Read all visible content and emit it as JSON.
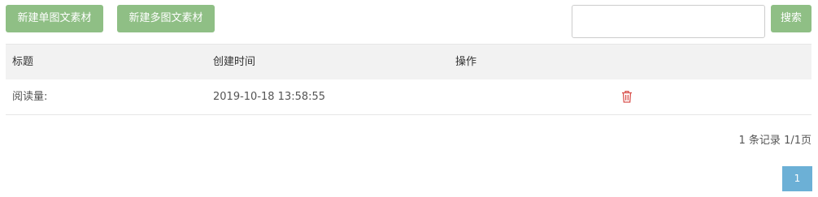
{
  "toolbar": {
    "new_single_label": "新建单图文素材",
    "new_multi_label": "新建多图文素材",
    "search_value": "",
    "search_placeholder": "",
    "search_label": "搜索"
  },
  "table": {
    "headers": [
      "标题",
      "创建时间",
      "操作"
    ],
    "rows": [
      {
        "title": "阅读量:",
        "created": "2019-10-18 13:58:55",
        "action_icon": "trash-icon"
      }
    ]
  },
  "pagination": {
    "summary": "1 条记录 1/1页",
    "current_page": "1"
  },
  "colors": {
    "button_green": "#8fbf85",
    "page_active": "#6cb0d6",
    "delete_red": "#d9534f"
  }
}
